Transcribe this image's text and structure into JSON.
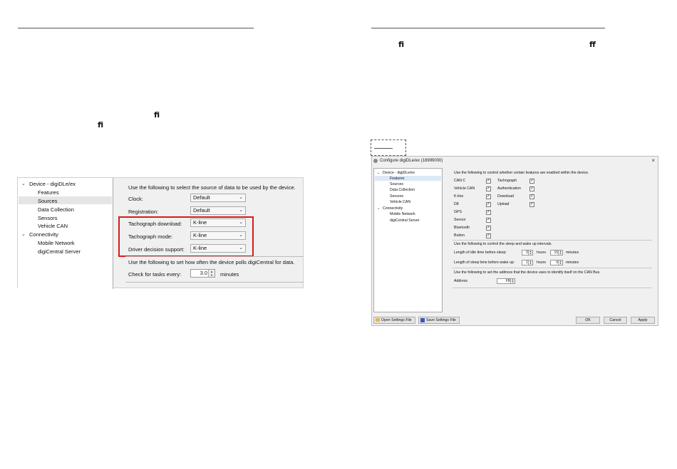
{
  "page": {
    "glyphs": {
      "left_1": "ﬁ",
      "left_2": "ﬁ",
      "right_1": "ﬁ",
      "right_2": "ﬀ"
    }
  },
  "left_screenshot": {
    "tree": {
      "device_label": "Device - digiDLe/ex",
      "items": [
        "Features",
        "Sources",
        "Data Collection",
        "Sensors",
        "Vehicle CAN"
      ],
      "selected": "Sources",
      "connectivity_label": "Connectivity",
      "connectivity_items": [
        "Mobile Network",
        "digiCentral Server"
      ]
    },
    "intro": "Use the following to select the source of data to be used by the device.",
    "rows": [
      {
        "label": "Clock:",
        "value": "Default"
      },
      {
        "label": "Registration:",
        "value": "Default"
      },
      {
        "label": "Tachograph download:",
        "value": "K-line"
      },
      {
        "label": "Tachograph mode:",
        "value": "K-line"
      },
      {
        "label": "Driver decision support:",
        "value": "K-line"
      }
    ],
    "poll_intro": "Use the following to set how often the device polls digiCentral for data.",
    "poll_label": "Check for tasks every:",
    "poll_value": "3.0",
    "poll_unit": "minutes"
  },
  "right_screenshot": {
    "title": "Configure digiDLe/ex (18999000)",
    "tree": {
      "device_label": "Device - digiDLe/ex",
      "items": [
        "Features",
        "Sources",
        "Data Collection",
        "Sensors",
        "Vehicle CAN"
      ],
      "selected": "Features",
      "connectivity_label": "Connectivity",
      "connectivity_items": [
        "Mobile Network",
        "digiCentral Server"
      ]
    },
    "features_intro": "Use the following to control whether certain features are enabled within the device.",
    "features_col1": [
      {
        "label": "CAN C",
        "checked": true
      },
      {
        "label": "Vehicle CAN",
        "checked": true
      },
      {
        "label": "K-line",
        "checked": true
      },
      {
        "label": "D8",
        "checked": true
      },
      {
        "label": "GPS",
        "checked": true
      },
      {
        "label": "Sensor",
        "checked": true
      },
      {
        "label": "Bluetooth",
        "checked": true
      },
      {
        "label": "Button",
        "checked": true
      }
    ],
    "features_col2": [
      {
        "label": "Tachograph",
        "checked": true
      },
      {
        "label": "Authentication",
        "checked": true
      },
      {
        "label": "Download",
        "checked": true
      },
      {
        "label": "Upload",
        "checked": true
      }
    ],
    "sleep_intro": "Use the following to control the sleep and wake up intervals.",
    "idle_label": "Length of idle time before sleep:",
    "idle_hours": "0",
    "idle_minutes": "15",
    "sleep_label": "Length of sleep time before wake up:",
    "sleep_hours": "1",
    "sleep_minutes": "0",
    "hours_unit": "hours",
    "minutes_unit": "minutes",
    "address_intro": "Use the following to set the address that the device uses to identify itself on the CAN Bus.",
    "address_label": "Address",
    "address_value": "FB",
    "buttons": {
      "open": "Open Settings File",
      "save": "Save Settings File",
      "ok": "OK",
      "cancel": "Cancel",
      "apply": "Apply"
    }
  }
}
